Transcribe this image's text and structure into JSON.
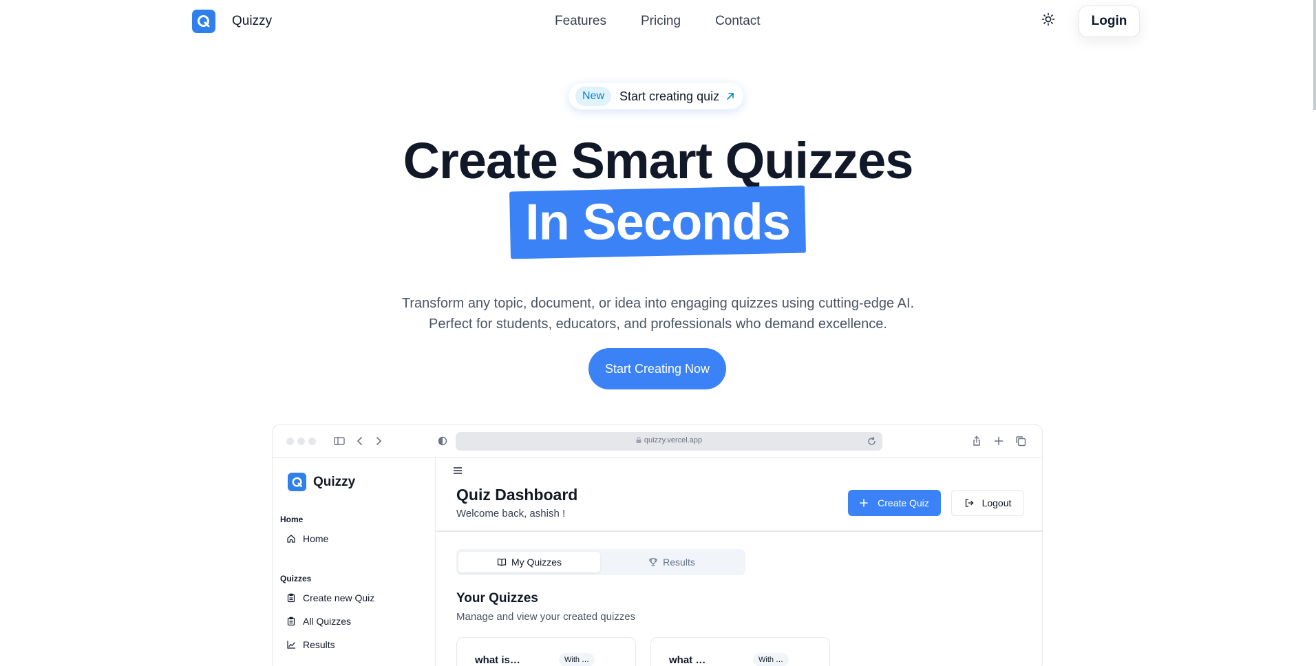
{
  "nav": {
    "brand": "Quizzy",
    "links": [
      "Features",
      "Pricing",
      "Contact"
    ],
    "login": "Login"
  },
  "hero": {
    "pill_badge": "New",
    "pill_text": "Start creating quiz",
    "title_line1": "Create Smart Quizzes",
    "title_line2": "In Seconds",
    "subtitle_line1": "Transform any topic, document, or idea into engaging quizzes using cutting-edge AI.",
    "subtitle_line2": "Perfect for students, educators, and professionals who demand excellence.",
    "cta": "Start Creating Now"
  },
  "mockup": {
    "url": "quizzy.vercel.app",
    "sidebar": {
      "brand": "Quizzy",
      "section_home": "Home",
      "item_home": "Home",
      "section_quizzes": "Quizzes",
      "item_create": "Create new Quiz",
      "item_all": "All Quizzes",
      "item_results": "Results"
    },
    "dashboard": {
      "title": "Quiz Dashboard",
      "welcome": "Welcome back, ashish !",
      "create_button": "Create Quiz",
      "logout_button": "Logout",
      "tab_my_quizzes": "My Quizzes",
      "tab_results": "Results",
      "section_title": "Your Quizzes",
      "section_subtitle": "Manage and view your created quizzes",
      "cards": [
        {
          "title": "what is…",
          "badge": "With …"
        },
        {
          "title": "what …",
          "badge": "With …"
        }
      ]
    }
  },
  "colors": {
    "accent": "#3b82f6",
    "brand_logo": "#2f80ed",
    "text_dark": "#111827",
    "text_muted": "#4b5563",
    "border": "#e5e7eb"
  },
  "icons": {
    "theme_toggle": "sun-icon",
    "pill_arrow": "arrow-up-right-icon",
    "create": "plus-icon",
    "logout": "logout-icon",
    "tab_my_quizzes": "book-open-icon",
    "tab_results": "trophy-icon"
  }
}
